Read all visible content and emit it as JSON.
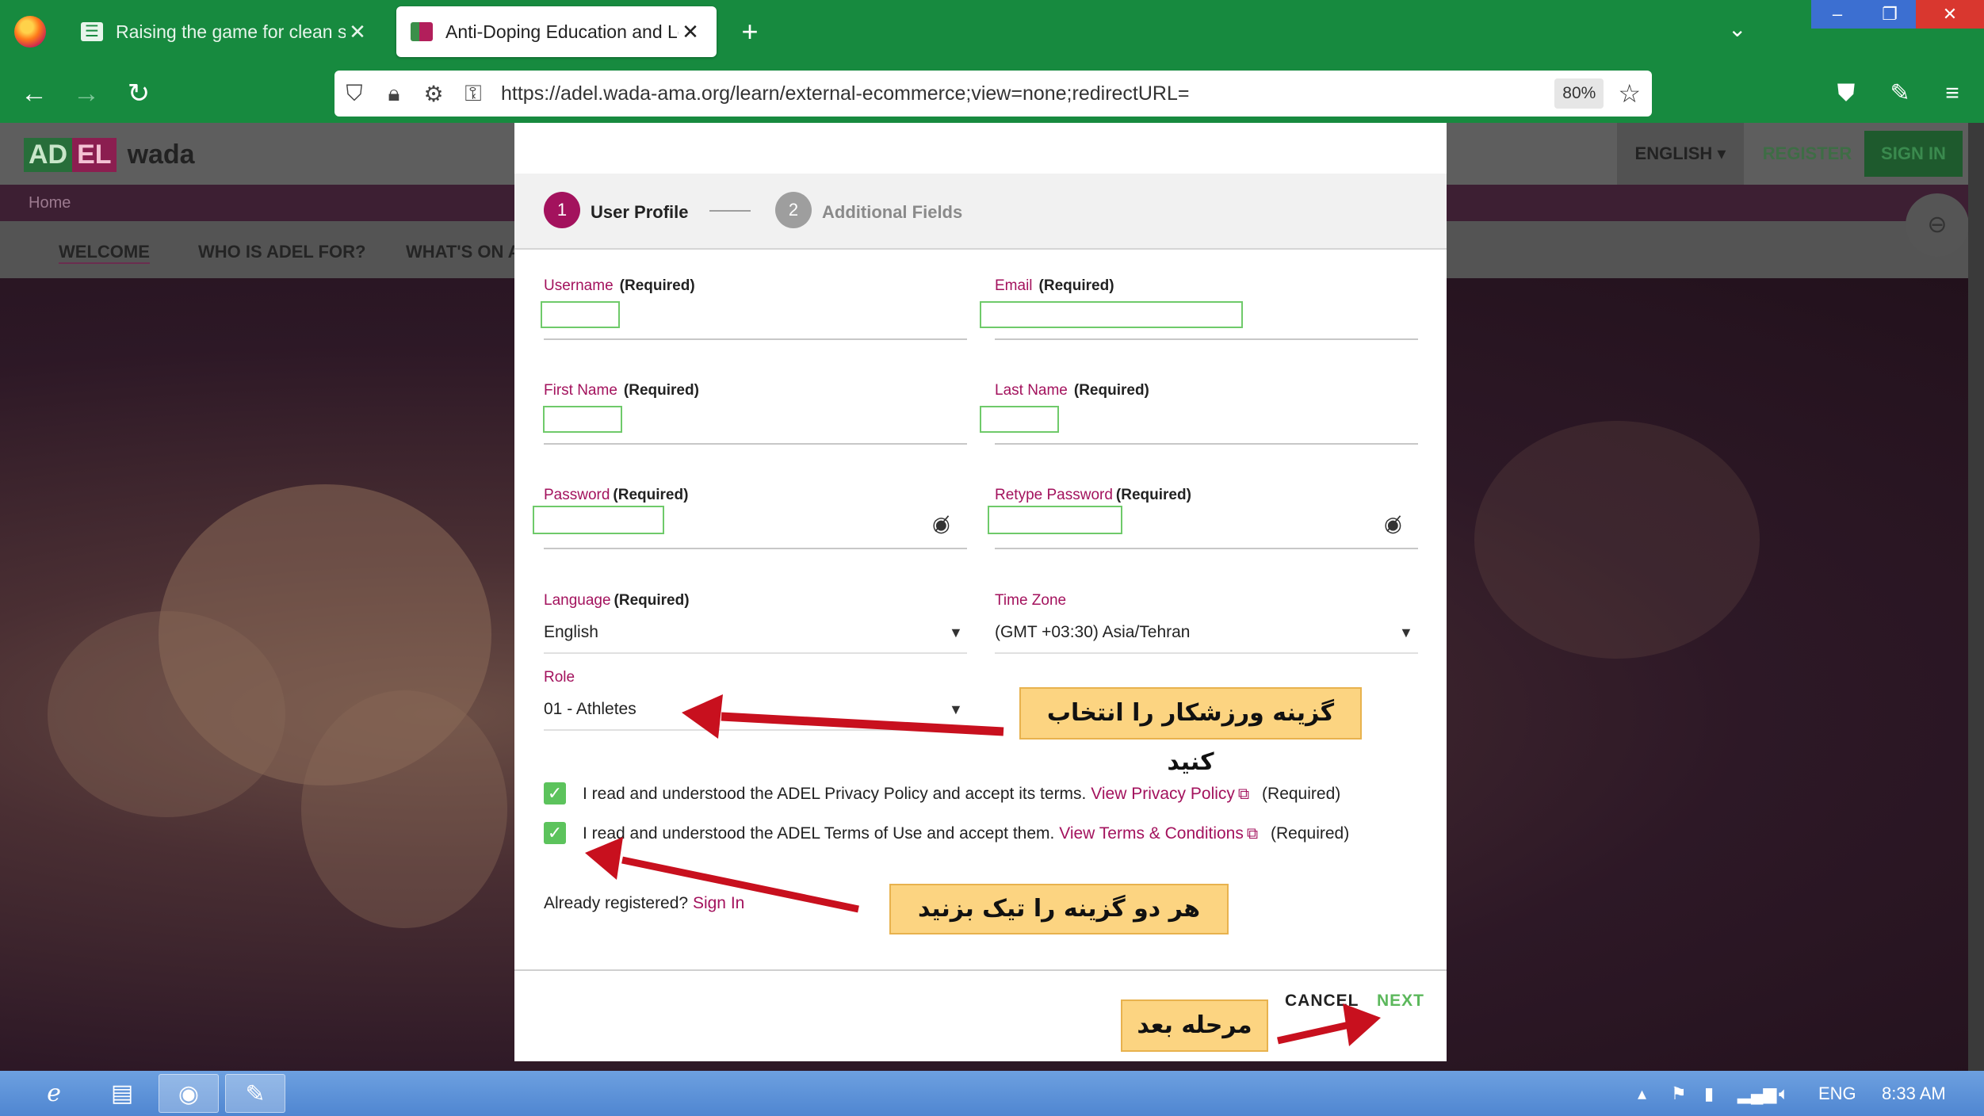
{
  "browser": {
    "tabs": [
      {
        "title": "Raising the game for clean spor"
      },
      {
        "title": "Anti-Doping Education and Lea"
      }
    ],
    "close_glyph": "✕",
    "new_tab": "+",
    "tab_list": "⌄",
    "url": "https://adel.wada-ama.org/learn/external-ecommerce;view=none;redirectURL=",
    "zoom": "80%",
    "window": {
      "minimize": "–",
      "restore": "❐",
      "close": "✕"
    }
  },
  "site": {
    "logo_ad": "AD",
    "logo_el": "EL",
    "logo_wada": "wada",
    "language": "ENGLISH ▾",
    "register": "REGISTER",
    "sign_in": "SIGN IN",
    "home": "Home",
    "subnav": [
      "WELCOME",
      "WHO IS ADEL FOR?",
      "WHAT'S ON A"
    ]
  },
  "modal": {
    "steps": [
      {
        "num": "1",
        "label": "User Profile"
      },
      {
        "num": "2",
        "label": "Additional Fields"
      }
    ],
    "fields": {
      "username": {
        "label": "Username",
        "req": "(Required)"
      },
      "email": {
        "label": "Email",
        "req": "(Required)"
      },
      "first_name": {
        "label": "First Name",
        "req": "(Required)"
      },
      "last_name": {
        "label": "Last Name",
        "req": "(Required)"
      },
      "password": {
        "label": "Password",
        "req": "(Required)"
      },
      "retype_password": {
        "label": "Retype Password",
        "req": "(Required)"
      },
      "language": {
        "label": "Language",
        "req": "(Required)",
        "value": "English"
      },
      "time_zone": {
        "label": "Time Zone",
        "value": "(GMT +03:30) Asia/Tehran"
      },
      "role": {
        "label": "Role",
        "value": "01 - Athletes"
      }
    },
    "consent_privacy": {
      "text": "I read and understood the ADEL Privacy Policy and accept its terms.",
      "link": "View Privacy Policy",
      "req": "(Required)"
    },
    "consent_terms": {
      "text": "I read and understood the ADEL Terms of Use and accept them.",
      "link": "View Terms & Conditions",
      "req": "(Required)"
    },
    "already_registered": "Already registered?",
    "sign_in_link": "Sign In",
    "cancel": "CANCEL",
    "next": "NEXT"
  },
  "annotations": {
    "role_note": "گزینه ورزشکار را انتخاب کنید",
    "checkbox_note": "هر دو گزینه را تیک بزنید",
    "next_note": "مرحله بعد",
    "arrow_color": "#c8101e"
  },
  "taskbar": {
    "language": "ENG",
    "time": "8:33 AM"
  },
  "colors": {
    "browser_green": "#178a3f",
    "accent": "#a3125d",
    "check_green": "#5cc35c",
    "note_fill": "#fcd481"
  }
}
